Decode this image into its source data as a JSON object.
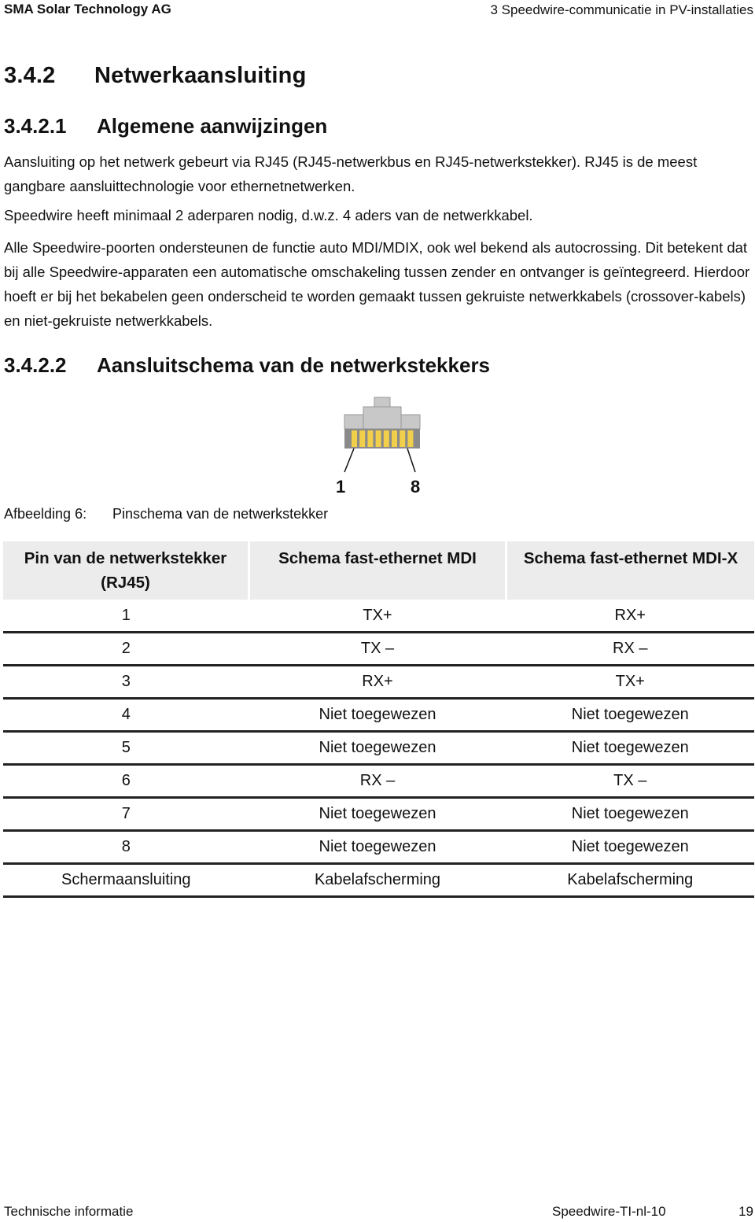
{
  "header": {
    "company": "SMA Solar Technology AG",
    "chapter": "3  Speedwire-communicatie in PV-installaties"
  },
  "section": {
    "number": "3.4.2",
    "title": "Netwerkaansluiting"
  },
  "subsection1": {
    "number": "3.4.2.1",
    "title": "Algemene aanwijzingen",
    "paragraphs": [
      "Aansluiting op het netwerk gebeurt via RJ45 (RJ45-netwerkbus en RJ45-netwerkstekker). RJ45 is de meest gangbare aansluittechnologie voor ethernetnetwerken.",
      "Speedwire heeft minimaal 2 aderparen nodig, d.w.z. 4 aders van de netwerkkabel.",
      "Alle Speedwire-poorten ondersteunen de functie auto MDI/MDIX, ook wel bekend als autocrossing. Dit betekent dat bij alle Speedwire-apparaten een automatische omschakeling tussen zender en ontvanger is geïntegreerd. Hierdoor hoeft er bij het bekabelen geen onderscheid te worden gemaakt tussen gekruiste netwerkkabels (crossover-kabels) en niet-gekruiste netwerkkabels."
    ]
  },
  "subsection2": {
    "number": "3.4.2.2",
    "title": "Aansluitschema van de netwerkstekkers"
  },
  "figure": {
    "icon": "rj45-connector-icon",
    "pin_first": "1",
    "pin_last": "8",
    "colors": {
      "body": "#c8c8c8",
      "contacts": "#f2cf4a",
      "side": "#8a8a8a"
    },
    "caption_label": "Afbeelding 6:",
    "caption_text": "Pinschema van de netwerkstekker"
  },
  "table": {
    "headers": [
      "Pin van de netwerkstekker (RJ45)",
      "Schema fast-ethernet MDI",
      "Schema fast-ethernet MDI-X"
    ],
    "rows": [
      [
        "1",
        "TX+",
        "RX+"
      ],
      [
        "2",
        "TX –",
        "RX –"
      ],
      [
        "3",
        "RX+",
        "TX+"
      ],
      [
        "4",
        "Niet toegewezen",
        "Niet toegewezen"
      ],
      [
        "5",
        "Niet toegewezen",
        "Niet toegewezen"
      ],
      [
        "6",
        "RX –",
        "TX –"
      ],
      [
        "7",
        "Niet toegewezen",
        "Niet toegewezen"
      ],
      [
        "8",
        "Niet toegewezen",
        "Niet toegewezen"
      ],
      [
        "Schermaansluiting",
        "Kabelafscherming",
        "Kabelafscherming"
      ]
    ]
  },
  "footer": {
    "left": "Technische informatie",
    "doc_id": "Speedwire-TI-nl-10",
    "page": "19"
  }
}
